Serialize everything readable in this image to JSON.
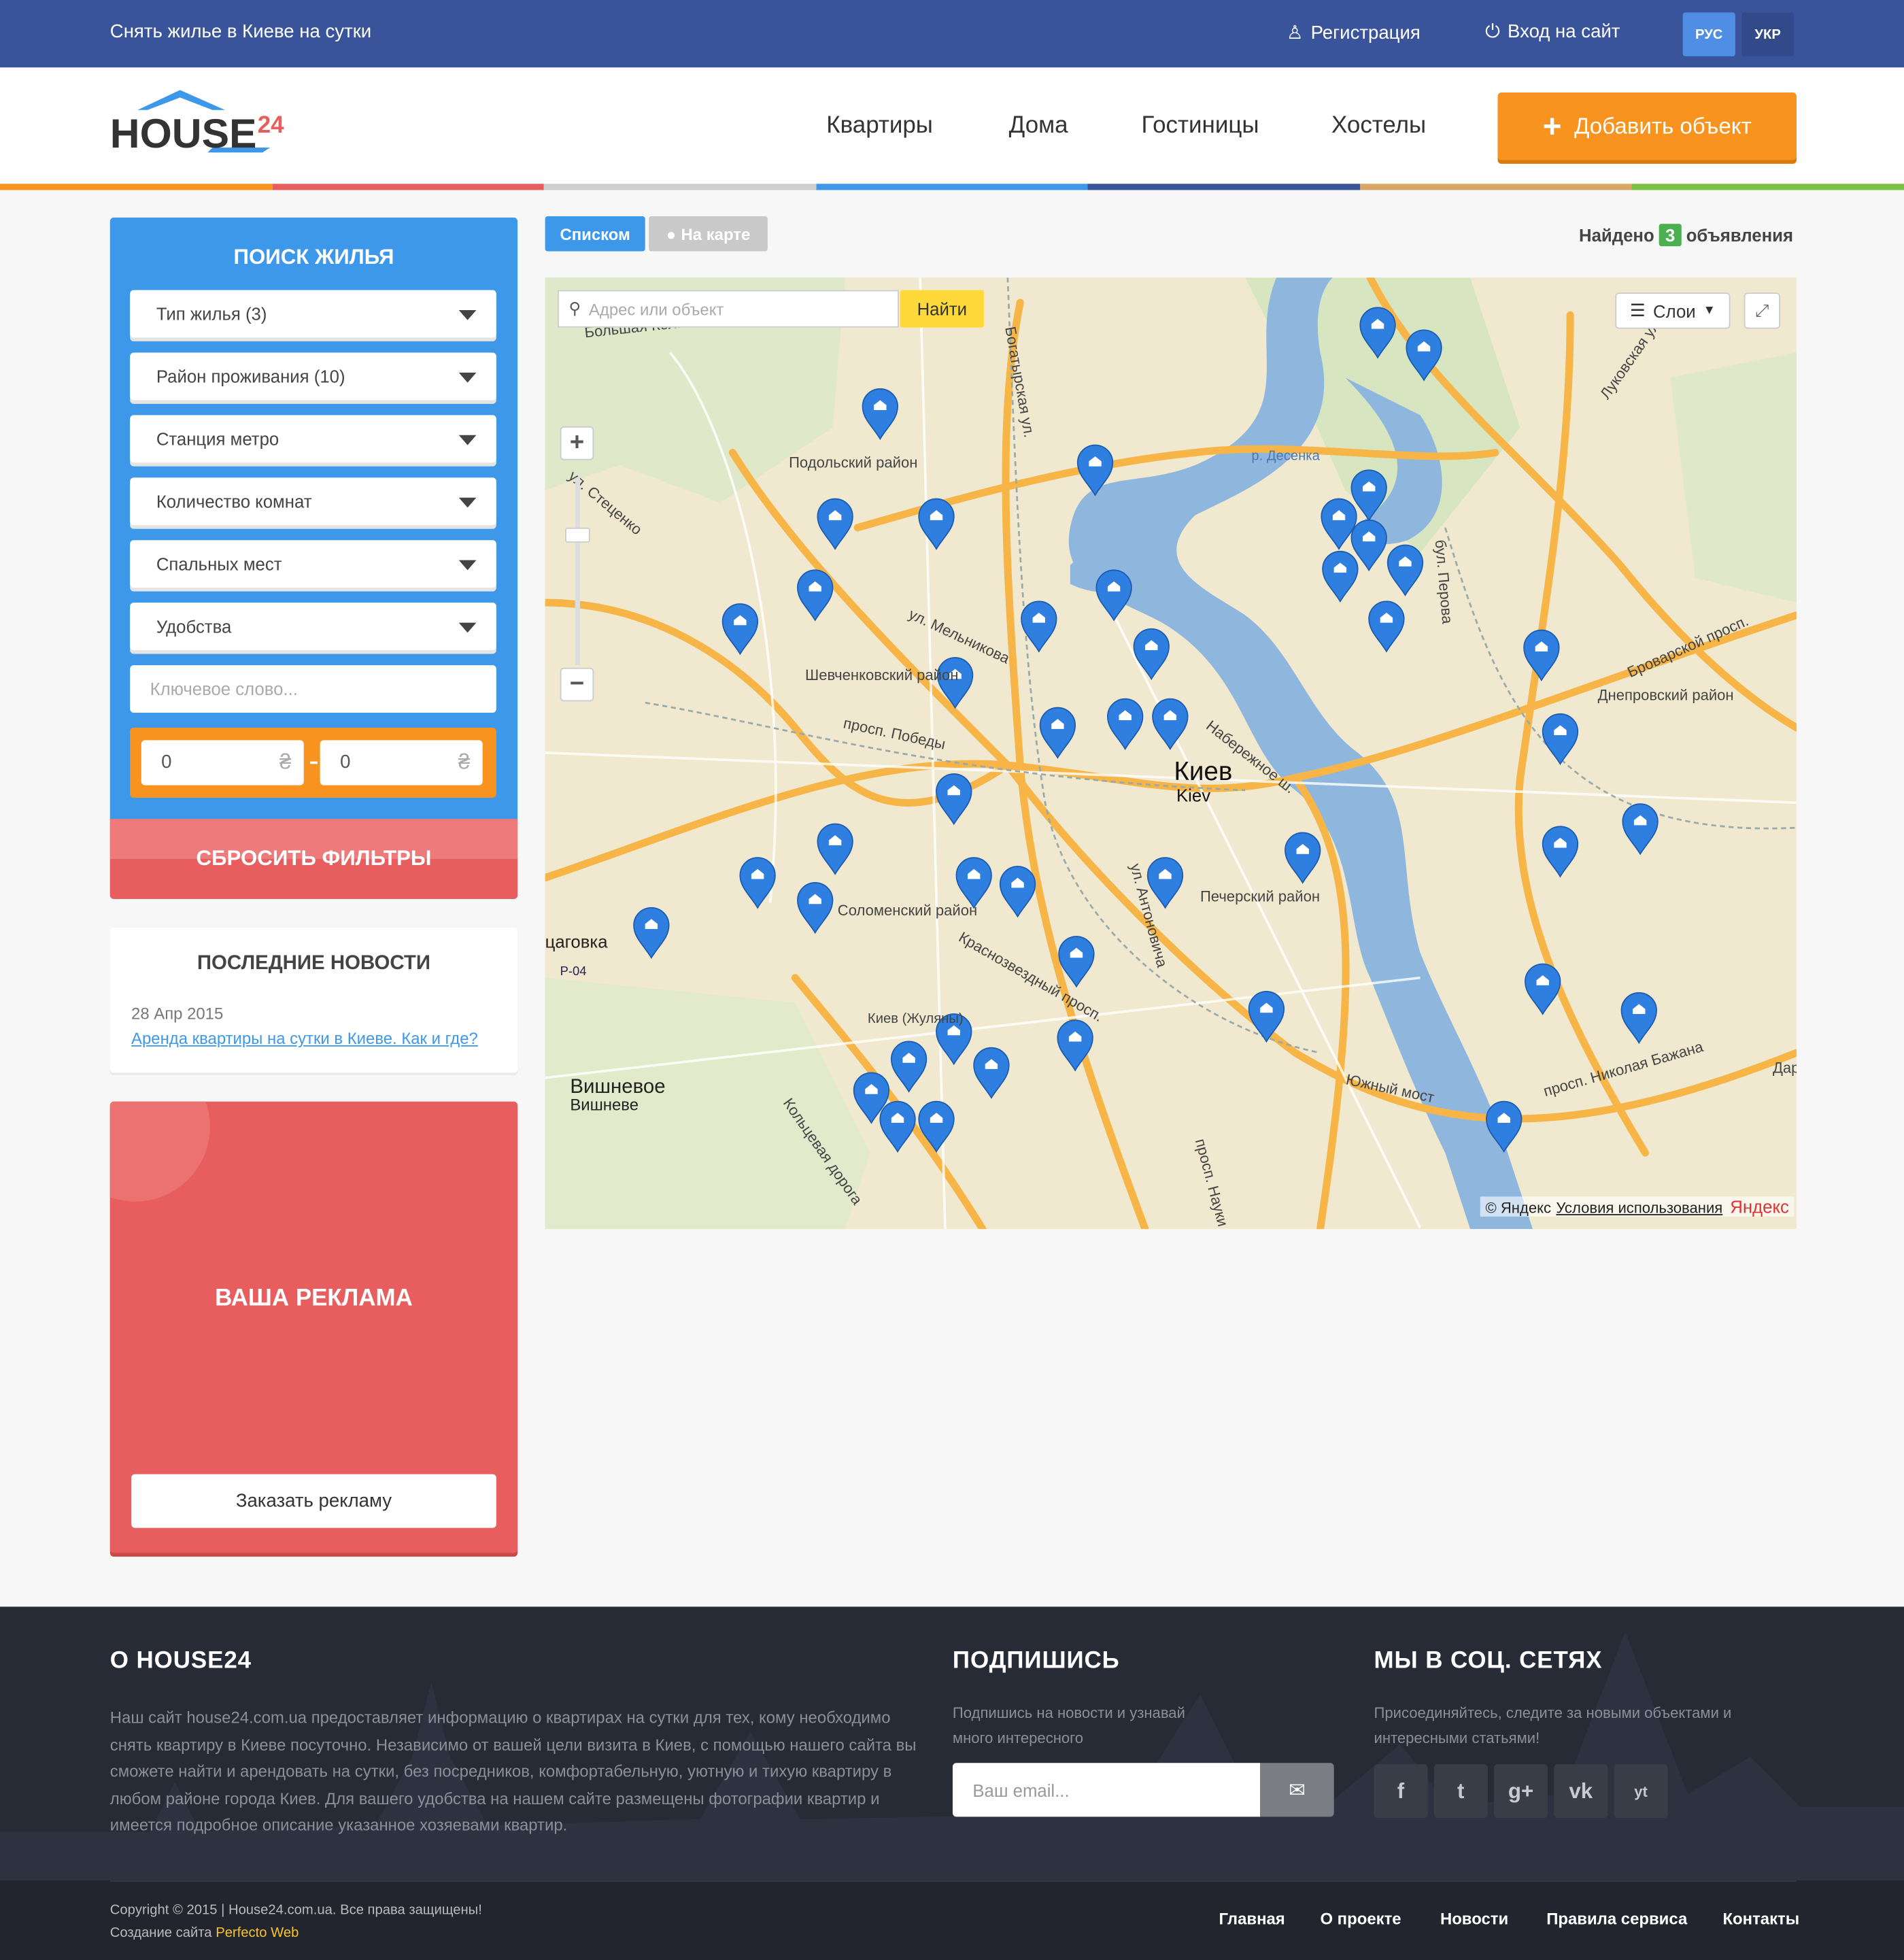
{
  "topbar": {
    "tagline": "Снять жилье в Киеве на сутки",
    "register": "Регистрация",
    "login": "Вход на сайт",
    "lang_ru": "РУС",
    "lang_uk": "УКР"
  },
  "header": {
    "logo_text": "HOUSE",
    "logo_num": "24",
    "nav": [
      "Квартиры",
      "Дома",
      "Гостиницы",
      "Хостелы"
    ],
    "add_button": "Добавить объект"
  },
  "search": {
    "title": "ПОИСК ЖИЛЬЯ",
    "selects": [
      "Тип жилья (3)",
      "Район проживания (10)",
      "Станция метро",
      "Количество комнат",
      "Спальных мест",
      "Удобства"
    ],
    "keyword_placeholder": "Ключевое слово...",
    "price_from": "0",
    "price_to": "0",
    "currency": "₴",
    "reset": "СБРОСИТЬ ФИЛЬТРЫ"
  },
  "news": {
    "title": "ПОСЛЕДНИЕ НОВОСТИ",
    "date": "28 Апр 2015",
    "link": "Аренда квартиры на сутки в Киеве. Как и где?"
  },
  "ad": {
    "title": "ВАША РЕКЛАМА",
    "button": "Заказать рекламу"
  },
  "results": {
    "tab_list": "Списком",
    "tab_map": "На карте",
    "found_prefix": "Найдено",
    "found_count": "3",
    "found_suffix": "объявления"
  },
  "map": {
    "search_placeholder": "Адрес или объект",
    "find": "Найти",
    "layers": "Слои",
    "city": "Киев",
    "city_en": "Kiev",
    "copyright": "© Яндекс",
    "terms": "Условия использования",
    "brand": "Яндекс",
    "labels": [
      "Подольский район",
      "Шевченковский район",
      "Соломенский район",
      "Печерский район",
      "Днепровский район",
      "Вишневое",
      "Вишневе",
      "Богатырская ул.",
      "ул. Мельникова",
      "просп. Победы",
      "Набережное ш.",
      "Красноз­вездный просп.",
      "ул. Антоновича",
      "Южный мост",
      "просп. Николая Бажана",
      "Броварской просп.",
      "Кольцевая дорога",
      "ул. Стеценко",
      "р. Десенка",
      "бул. Перова",
      "Луковская ул.",
      "просп. Науки",
      "Киев (Жуляны)",
      "Большая Кол...",
      "цаговка",
      "Р-04",
      "Дар"
    ]
  },
  "footer": {
    "about_title": "О HOUSE24",
    "about_text": "Наш сайт house24.com.ua предоставляет информацию о квартирах на сутки для тех, кому необходимо снять квартиру в Киеве посуточно. Независимо от вашей цели визита в Киев, с помощью нашего сайта вы сможете найти и арендовать на сутки, без посредников, комфортабельную, уютную и тихую квартиру в любом районе города Киев. Для вашего удобства на нашем сайте размещены фотографии квартир и имеется подробное описание указанное хозяевами квартир.",
    "sub_title": "ПОДПИШИСЬ",
    "sub_text": "Подпишись на новости и узнавай много интересного",
    "email_placeholder": "Ваш email...",
    "social_title": "МЫ В СОЦ. СЕТЯХ",
    "social_text": "Присоединяйтесь, следите за новыми объектами и интересными статьями!",
    "social": [
      "f",
      "t",
      "g+",
      "vk",
      "yt"
    ],
    "copyright": "Copyright © 2015 | House24.com.ua. Все права защищены!",
    "made_by": "Создание сайта",
    "made_by_name": "Perfecto Web",
    "links": [
      "Главная",
      "О проекте",
      "Новости",
      "Правила сервиса",
      "Контакты"
    ]
  },
  "colors": {
    "topbar": "#3a549c",
    "accent_blue": "#3e98ea",
    "orange": "#f7931e",
    "red": "#e85e5e",
    "footer": "#272b36"
  }
}
